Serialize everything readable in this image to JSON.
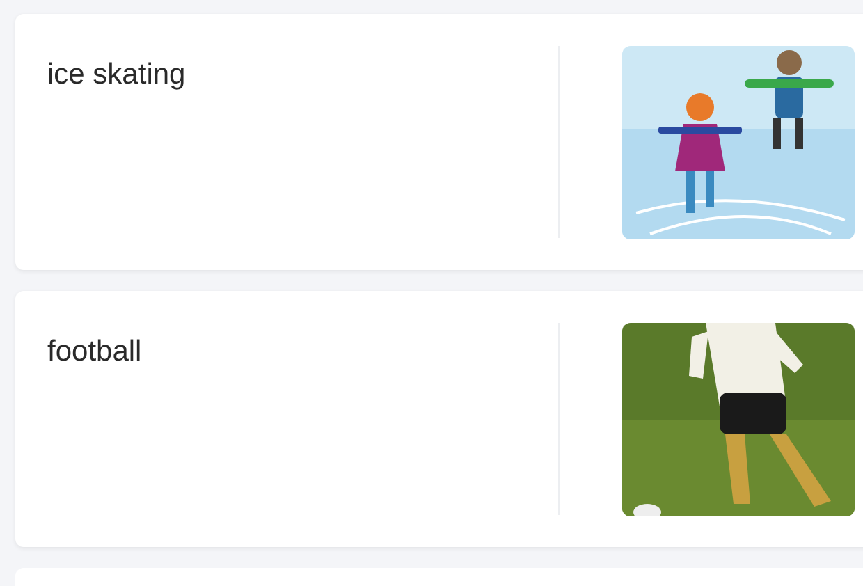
{
  "cards": [
    {
      "kind": "card",
      "title": "ice skating"
    },
    {
      "kind": "card",
      "title": "football"
    },
    {
      "kind": "stub"
    }
  ]
}
